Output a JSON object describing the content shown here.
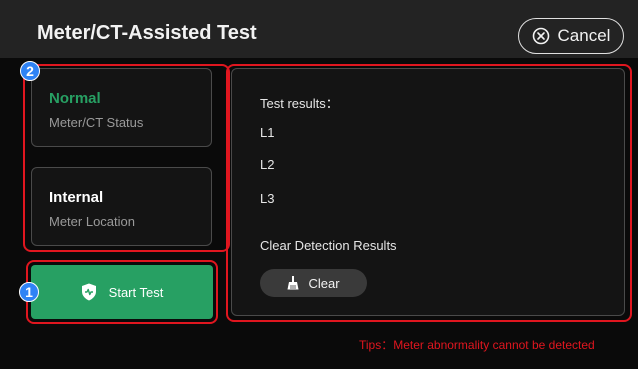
{
  "header": {
    "title": "Meter/CT-Assisted Test",
    "cancel_label": "Cancel"
  },
  "status_card": {
    "value": "Normal",
    "label": "Meter/CT Status",
    "value_color": "#27a063"
  },
  "location_card": {
    "value": "Internal",
    "label": "Meter Location"
  },
  "results": {
    "heading": "Test results：",
    "lines": [
      "L1",
      "L2",
      "L3"
    ],
    "clear_heading": "Clear Detection Results",
    "clear_button": "Clear"
  },
  "start_button": {
    "label": "Start Test"
  },
  "badges": [
    "1",
    "2"
  ],
  "tips": "Tips：Meter abnormality cannot be detected",
  "colors": {
    "accent_green": "#27a063",
    "annotation_red": "#e0161f",
    "badge_blue": "#2f83f5"
  }
}
